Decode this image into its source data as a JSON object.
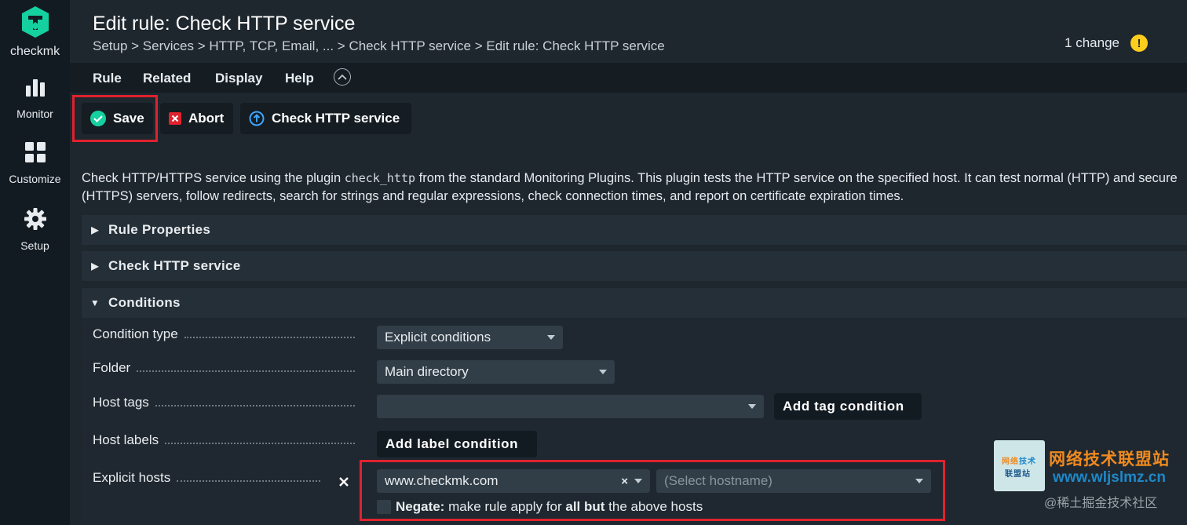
{
  "sidebar": {
    "logo_text": "checkmk",
    "items": [
      {
        "label": "Monitor",
        "icon": "bar-chart-icon"
      },
      {
        "label": "Customize",
        "icon": "grid-icon"
      },
      {
        "label": "Setup",
        "icon": "gear-icon"
      }
    ]
  },
  "header": {
    "title": "Edit rule: Check HTTP service",
    "breadcrumb": "Setup > Services > HTTP, TCP, Email, ... > Check HTTP service > Edit rule: Check HTTP service",
    "changes": "1 change",
    "changes_icon": "!"
  },
  "menubar": {
    "items": [
      "Rule",
      "Related",
      "Display",
      "Help"
    ]
  },
  "toolbar": {
    "save_label": "Save",
    "abort_label": "Abort",
    "ruleset_label": "Check HTTP service"
  },
  "help": {
    "part1": "Check HTTP/HTTPS service using the plugin ",
    "code": "check_http",
    "part2": " from the standard Monitoring Plugins. This plugin tests the HTTP service on the specified host. It can test normal (HTTP) and secure (HTTPS) servers, follow redirects, search for strings and regular expressions, check connection times, and report on certificate expiration times."
  },
  "sections": {
    "rule_properties": "Rule Properties",
    "check_http": "Check HTTP service",
    "conditions": "Conditions"
  },
  "conditions": {
    "condition_type": {
      "label": "Condition type",
      "value": "Explicit conditions"
    },
    "folder": {
      "label": "Folder",
      "value": "Main directory"
    },
    "host_tags": {
      "label": "Host tags",
      "value": "",
      "button": "Add tag condition"
    },
    "host_labels": {
      "label": "Host labels",
      "button": "Add label condition"
    },
    "explicit_hosts": {
      "label": "Explicit hosts",
      "value": "www.checkmk.com",
      "clear": "×",
      "placeholder": "(Select hostname)",
      "negate_bold": "Negate:",
      "negate_text1": " make rule apply for ",
      "negate_bold2": "all but",
      "negate_text2": " the above hosts"
    }
  },
  "watermark": {
    "logo_chars": [
      "网",
      "络",
      "技",
      "术",
      "联",
      "盟",
      "站"
    ],
    "title": "网络技术联盟站",
    "url": "www.wljslmz.cn",
    "credit": "@稀土掘金技术社区"
  },
  "colors": {
    "accent_teal": "#15d1a0",
    "highlight_red": "#e0222e",
    "warning_yellow": "#ffcd1d"
  }
}
